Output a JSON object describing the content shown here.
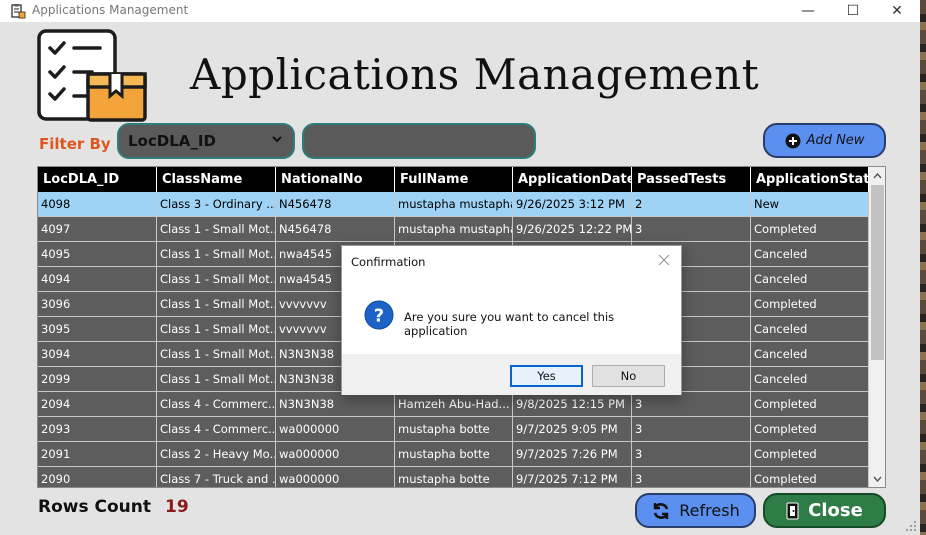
{
  "window": {
    "title": "Applications Management",
    "controls": {
      "minimize": "—",
      "maximize": "☐",
      "close": "✕"
    }
  },
  "header": {
    "title": "Applications Management"
  },
  "filter": {
    "label": "Filter By",
    "selected": "LocDLA_ID",
    "search_value": ""
  },
  "buttons": {
    "add_new": "Add New",
    "refresh": "Refresh",
    "close": "Close"
  },
  "table": {
    "columns": [
      "LocDLA_ID",
      "ClassName",
      "NationalNo",
      "FullName",
      "ApplicationDate",
      "PassedTests",
      "ApplicationStatus"
    ],
    "rows": [
      [
        "4098",
        "Class 3 - Ordinary ...",
        "N456478",
        "mustapha mustapha",
        "9/26/2025 3:12 PM",
        "2",
        "New"
      ],
      [
        "4097",
        "Class 1 - Small Mot...",
        "N456478",
        "mustapha mustapha",
        "9/26/2025 12:22 PM",
        "3",
        "Completed"
      ],
      [
        "4095",
        "Class 1 - Small Mot...",
        "nwa4545",
        "",
        "",
        "",
        "Canceled"
      ],
      [
        "4094",
        "Class 1 - Small Mot...",
        "nwa4545",
        "",
        "",
        "",
        "Canceled"
      ],
      [
        "3096",
        "Class 1 - Small Mot...",
        "vvvvvvv",
        "",
        "",
        "",
        "Completed"
      ],
      [
        "3095",
        "Class 1 - Small Mot...",
        "vvvvvvv",
        "",
        "",
        "",
        "Canceled"
      ],
      [
        "3094",
        "Class 1 - Small Mot...",
        "N3N3N38",
        "",
        "",
        "",
        "Canceled"
      ],
      [
        "2099",
        "Class 1 - Small Mot...",
        "N3N3N38",
        "",
        "",
        "",
        "Canceled"
      ],
      [
        "2094",
        "Class 4 - Commerc...",
        "N3N3N38",
        "Hamzeh Abu-Had...",
        "9/8/2025 12:15 PM",
        "3",
        "Completed"
      ],
      [
        "2093",
        "Class 4 - Commerc...",
        "wa000000",
        "mustapha botte",
        "9/7/2025 9:05 PM",
        "3",
        "Completed"
      ],
      [
        "2091",
        "Class 2 - Heavy Mo...",
        "wa000000",
        "mustapha botte",
        "9/7/2025 7:26 PM",
        "3",
        "Completed"
      ],
      [
        "2090",
        "Class 7 - Truck and ...",
        "wa000000",
        "mustapha botte",
        "9/7/2025 7:12 PM",
        "3",
        "Completed"
      ]
    ],
    "selected_row": 0
  },
  "footer": {
    "rows_count_label": "Rows Count",
    "rows_count_value": "19"
  },
  "dialog": {
    "title": "Confirmation",
    "message": "Are you sure you want to cancel this application",
    "yes": "Yes",
    "no": "No",
    "icon": "question-icon"
  },
  "colors": {
    "accent_blue": "#5b8ff0",
    "close_green": "#2e7d46",
    "filter_label": "#e0561f",
    "selected_row": "#9ed3f5",
    "count_red": "#8b1a1a"
  }
}
